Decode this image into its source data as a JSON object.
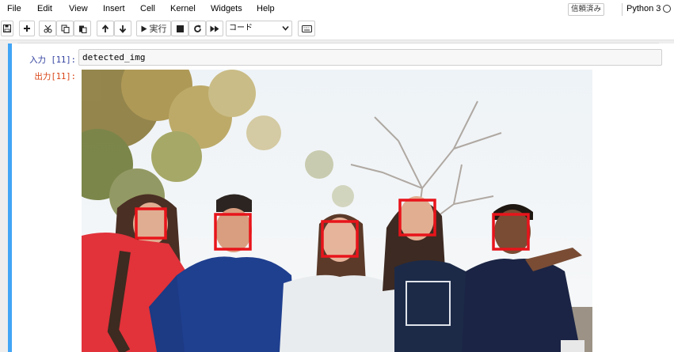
{
  "menu": {
    "items": [
      {
        "label": "File"
      },
      {
        "label": "Edit"
      },
      {
        "label": "View"
      },
      {
        "label": "Insert"
      },
      {
        "label": "Cell"
      },
      {
        "label": "Kernel"
      },
      {
        "label": "Widgets"
      },
      {
        "label": "Help"
      }
    ],
    "trusted_label": "信頼済み",
    "kernel_name": "Python 3"
  },
  "toolbar": {
    "run_label": "実行",
    "cell_type": "コード",
    "icons": [
      "save-icon",
      "plus-icon",
      "cut-icon",
      "copy-icon",
      "paste-icon",
      "arrow-up-icon",
      "arrow-down-icon",
      "run-icon",
      "stop-icon",
      "restart-icon",
      "fast-forward-icon",
      "keyboard-icon"
    ]
  },
  "cell": {
    "input_prompt": "入力 [11]:",
    "code": "detected_img",
    "output_prompt": "出力[11]:",
    "accent_color": "#42a5f5",
    "detection_box_color": "#e8141b",
    "detected_faces": 5
  }
}
